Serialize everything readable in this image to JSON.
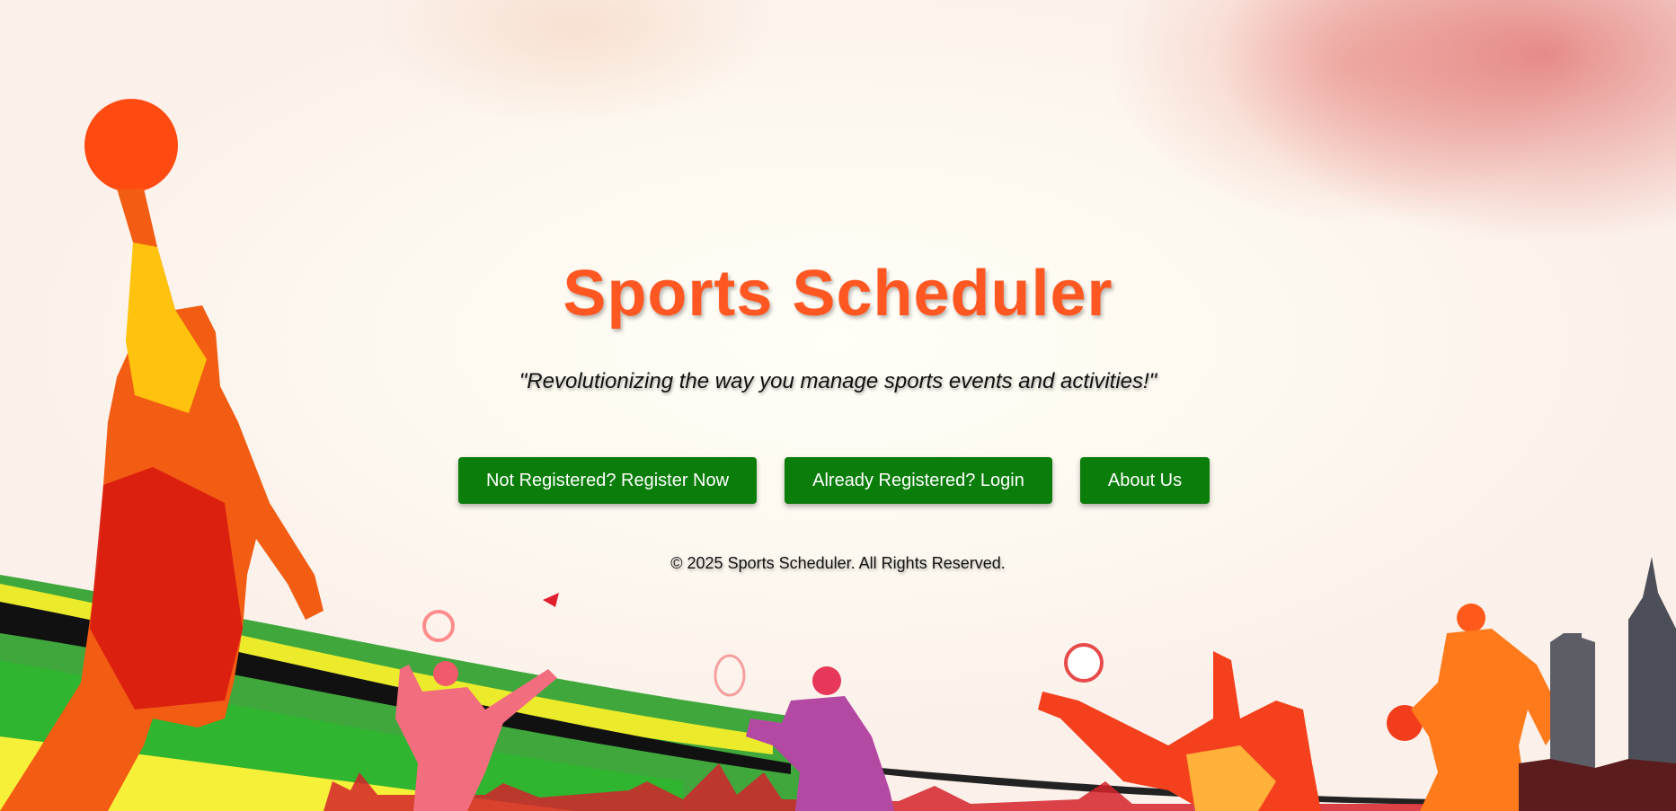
{
  "hero": {
    "title": "Sports Scheduler",
    "tagline": "\"Revolutionizing the way you manage sports events and activities!\""
  },
  "actions": {
    "register_label": "Not Registered? Register Now",
    "login_label": "Already Registered? Login",
    "about_label": "About Us"
  },
  "footer": {
    "copyright": "© 2025 Sports Scheduler. All Rights Reserved."
  },
  "colors": {
    "title": "#ff5722",
    "button_bg": "#0a7d0a",
    "button_text": "#ffffff"
  }
}
